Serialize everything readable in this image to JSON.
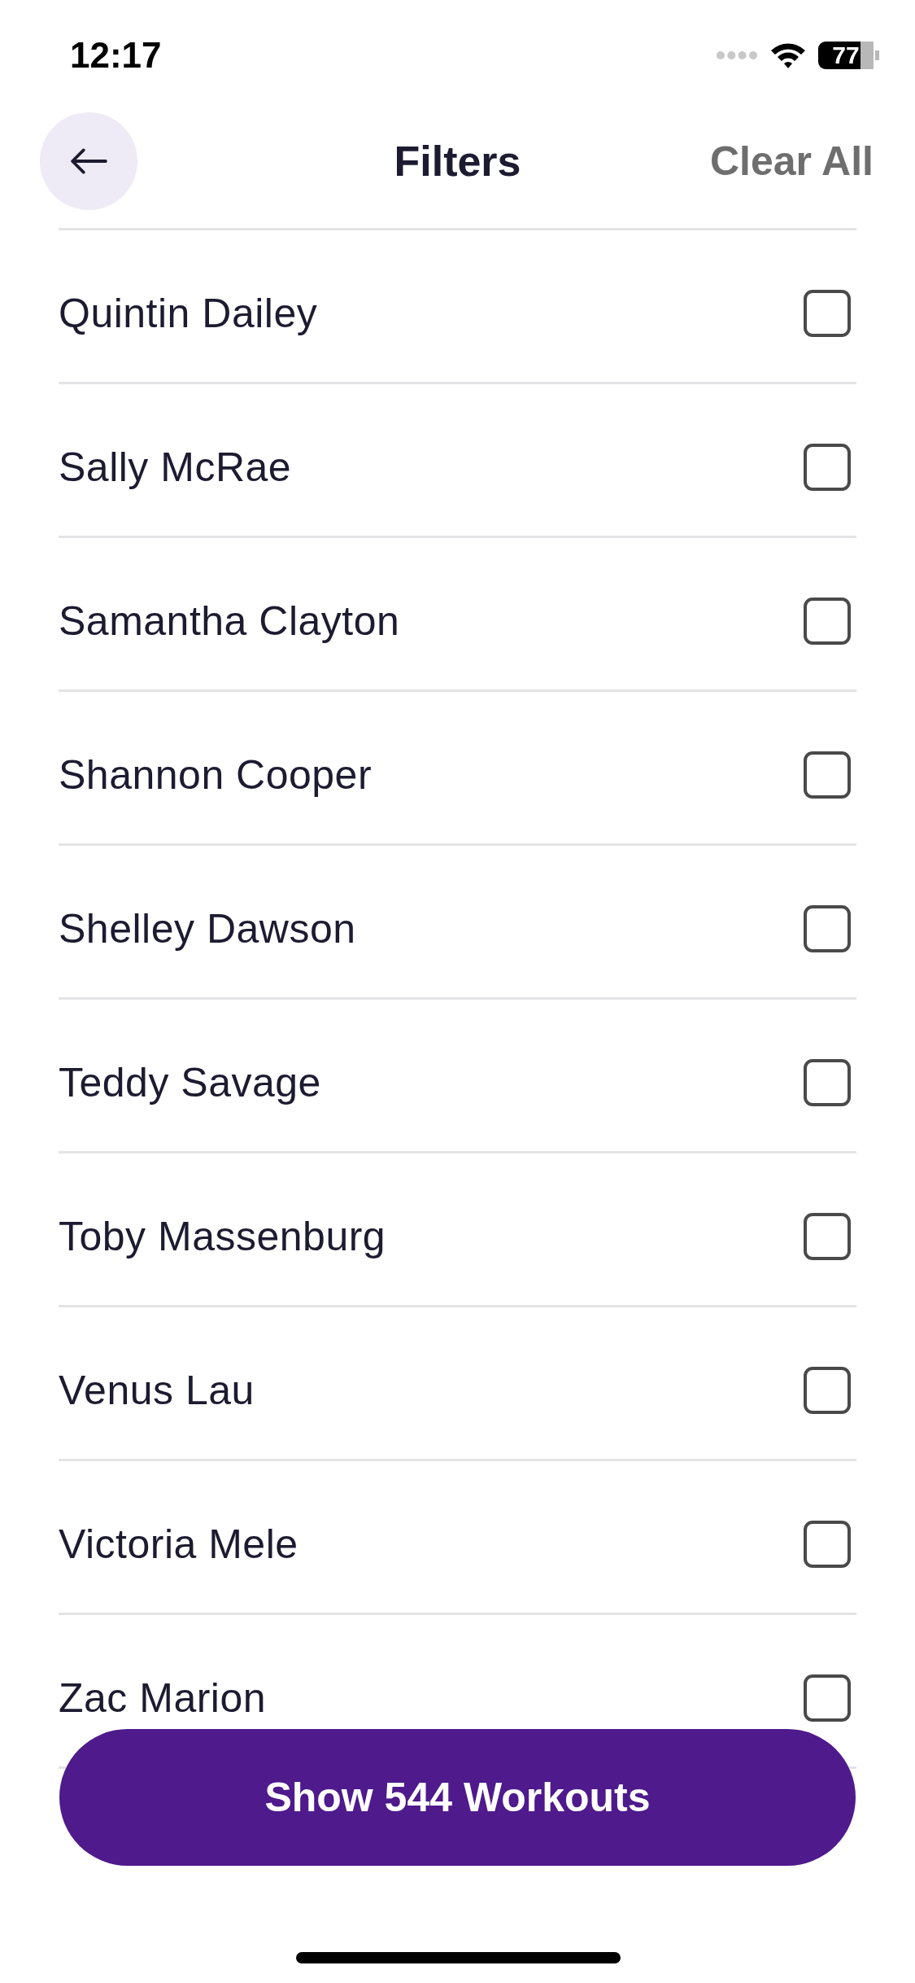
{
  "status_bar": {
    "time": "12:17",
    "battery": "77"
  },
  "header": {
    "title": "Filters",
    "action": "Clear All"
  },
  "instructors": [
    {
      "name": "Quintin Dailey",
      "checked": false
    },
    {
      "name": "Sally McRae",
      "checked": false
    },
    {
      "name": "Samantha Clayton",
      "checked": false
    },
    {
      "name": "Shannon Cooper",
      "checked": false
    },
    {
      "name": "Shelley Dawson",
      "checked": false
    },
    {
      "name": "Teddy Savage",
      "checked": false
    },
    {
      "name": "Toby Massenburg",
      "checked": false
    },
    {
      "name": "Venus Lau",
      "checked": false
    },
    {
      "name": "Victoria Mele",
      "checked": false
    },
    {
      "name": "Zac Marion",
      "checked": false
    }
  ],
  "show_button": {
    "label": "Show 544 Workouts"
  }
}
